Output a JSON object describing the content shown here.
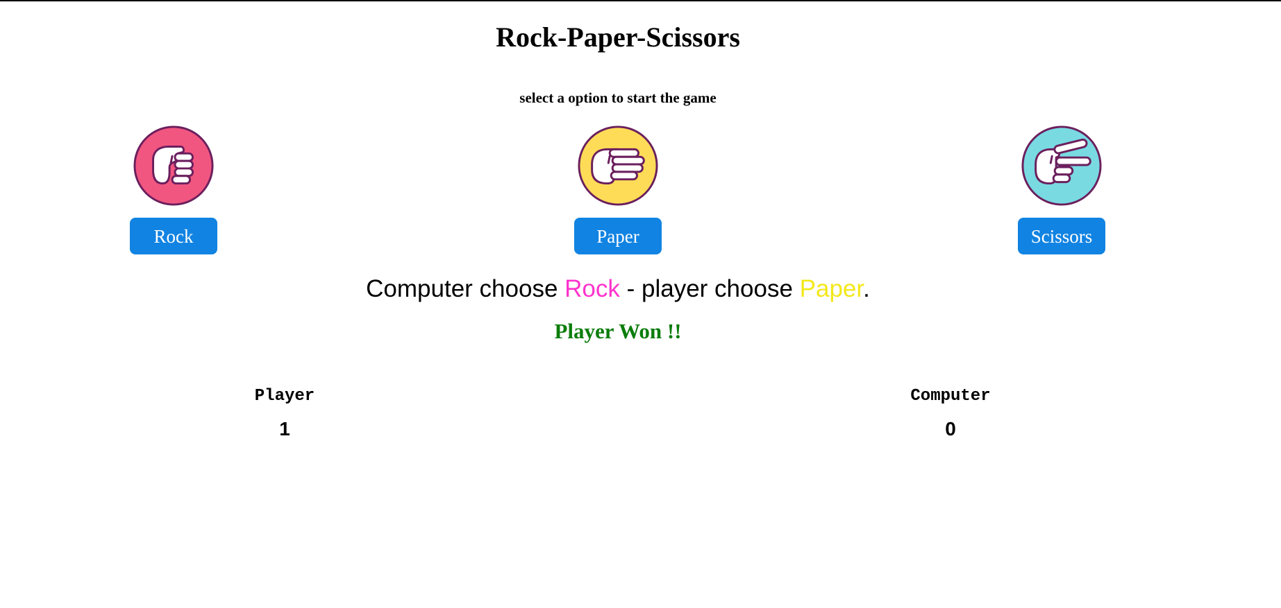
{
  "header": {
    "title": "Rock-Paper-Scissors",
    "subtitle": "select a option to start the game"
  },
  "choices": [
    {
      "label": "Rock",
      "icon": "rock-hand-icon",
      "color": "#f15680"
    },
    {
      "label": "Paper",
      "icon": "paper-hand-icon",
      "color": "#fedc57"
    },
    {
      "label": "Scissors",
      "icon": "scissors-hand-icon",
      "color": "#79dae2"
    }
  ],
  "result": {
    "prefix": "Computer choose ",
    "computer_choice": "Rock",
    "middle": " - player choose ",
    "player_choice": "Paper",
    "suffix": ".",
    "computer_choice_color": "#ff33cc",
    "player_choice_color": "#f3e81a",
    "winner_text": "Player Won !!",
    "winner_color": "#0b7d0b"
  },
  "score": {
    "player_label": "Player",
    "player_value": "1",
    "computer_label": "Computer",
    "computer_value": "0"
  },
  "colors": {
    "button_bg": "#1183e2",
    "icon_outline": "#6b1f5d"
  }
}
